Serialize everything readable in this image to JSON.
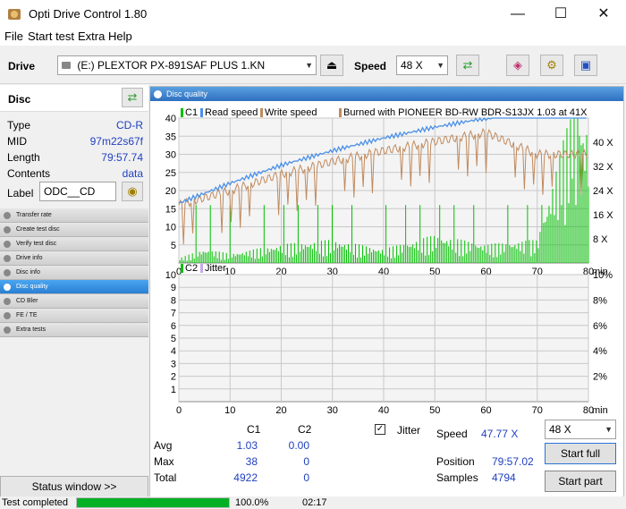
{
  "window": {
    "title": "Opti Drive Control 1.80"
  },
  "menu": [
    "File",
    "Start test",
    "Extra",
    "Help"
  ],
  "drive": {
    "label": "Drive",
    "selected": "(E:)   PLEXTOR PX-891SAF PLUS 1.KN",
    "speed_label": "Speed",
    "speed_value": "48 X"
  },
  "disc": {
    "header": "Disc",
    "rows": [
      {
        "label": "Type",
        "value": "CD-R"
      },
      {
        "label": "MID",
        "value": "97m22s67f"
      },
      {
        "label": "Length",
        "value": "79:57.74"
      },
      {
        "label": "Contents",
        "value": "data"
      }
    ],
    "label_label": "Label",
    "label_value": "ODC__CD"
  },
  "nav": [
    {
      "label": "Transfer rate",
      "active": false
    },
    {
      "label": "Create test disc",
      "active": false
    },
    {
      "label": "Verify test disc",
      "active": false
    },
    {
      "label": "Drive info",
      "active": false
    },
    {
      "label": "Disc info",
      "active": false
    },
    {
      "label": "Disc quality",
      "active": true
    },
    {
      "label": "CD Bler",
      "active": false
    },
    {
      "label": "FE / TE",
      "active": false
    },
    {
      "label": "Extra tests",
      "active": false
    }
  ],
  "status_window_btn": "Status window >>",
  "panel": {
    "title": "Disc quality",
    "legend_top": [
      "C1",
      "Read speed",
      "Write speed",
      "Burned with PIONEER BD-RW   BDR-S13JX 1.03 at 41X"
    ],
    "legend_bottom": [
      "C2",
      "Jitter"
    ]
  },
  "chart_data": [
    {
      "type": "line",
      "name_left": "C1",
      "x_ticks": [
        "0",
        "10",
        "20",
        "30",
        "40",
        "50",
        "60",
        "70",
        "80"
      ],
      "x_unit": "min",
      "y_left_ticks": [
        "5",
        "10",
        "15",
        "20",
        "25",
        "30",
        "35",
        "40"
      ],
      "y_right_ticks": [
        "8 X",
        "16 X",
        "24 X",
        "32 X",
        "40 X"
      ],
      "xlim": [
        0,
        80
      ],
      "ylim": [
        0,
        40
      ],
      "y2lim": [
        0,
        48
      ],
      "series": [
        {
          "name": "Read speed",
          "color": "#4a90e8",
          "x": [
            0,
            10,
            20,
            30,
            40,
            50,
            60,
            70,
            80
          ],
          "y": [
            16.5,
            22,
            27,
            31,
            34.5,
            37.5,
            40,
            43,
            45.5
          ]
        },
        {
          "name": "Write speed",
          "color": "#c08a5e",
          "x": [
            0,
            10,
            20,
            30,
            40,
            50,
            60,
            70,
            80
          ],
          "y": [
            16,
            20,
            24.5,
            28,
            31,
            33.5,
            36,
            30,
            30
          ]
        },
        {
          "name": "C1",
          "color": "#00c000",
          "x": [
            0,
            5,
            10,
            20,
            30,
            40,
            50,
            60,
            70,
            78,
            79
          ],
          "y": [
            1,
            3,
            2,
            4,
            5,
            3,
            6,
            4,
            5,
            38,
            30
          ]
        }
      ]
    },
    {
      "type": "line",
      "name_left": "C2",
      "x_ticks": [
        "0",
        "10",
        "20",
        "30",
        "40",
        "50",
        "60",
        "70",
        "80"
      ],
      "x_unit": "min",
      "y_left_ticks": [
        "1",
        "2",
        "3",
        "4",
        "5",
        "6",
        "7",
        "8",
        "9",
        "10"
      ],
      "y_right_ticks": [
        "2%",
        "4%",
        "6%",
        "8%",
        "10%"
      ],
      "xlim": [
        0,
        80
      ],
      "ylim": [
        0,
        10
      ],
      "series": []
    }
  ],
  "stats": {
    "col_c1": "C1",
    "col_c2": "C2",
    "rows": [
      {
        "label": "Avg",
        "c1": "1.03",
        "c2": "0.00"
      },
      {
        "label": "Max",
        "c1": "38",
        "c2": "0"
      },
      {
        "label": "Total",
        "c1": "4922",
        "c2": "0"
      }
    ],
    "jitter_label": "Jitter",
    "speed_label": "Speed",
    "speed_value": "47.77 X",
    "position_label": "Position",
    "position_value": "79:57.02",
    "samples_label": "Samples",
    "samples_value": "4794",
    "speed_select": "48 X",
    "start_full": "Start full",
    "start_part": "Start part"
  },
  "status": {
    "text": "Test completed",
    "progress": 100,
    "percent": "100.0%",
    "time": "02:17"
  }
}
